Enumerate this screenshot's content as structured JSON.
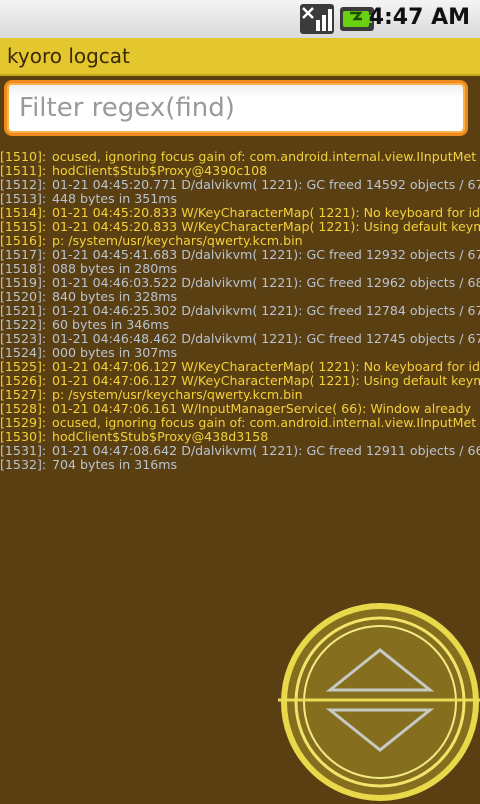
{
  "status_bar": {
    "time": "4:47 AM",
    "signal_icon": "signal-icon",
    "battery_icon": "battery-charging-icon"
  },
  "app": {
    "title": "kyoro logcat"
  },
  "filter": {
    "placeholder": "Filter regex(find)",
    "value": ""
  },
  "colors": {
    "background": "#5a3f12",
    "title_bar": "#e4c62f",
    "info_text": "#f2d23a",
    "debug_text": "#b9c4d0",
    "focus_orange": "#f08a1c"
  },
  "log": [
    {
      "num": "[1510]:",
      "text": "ocused, ignoring focus gain of: com.android.internal.view.IInputMet",
      "level": "I"
    },
    {
      "num": "[1511]:",
      "text": "hodClient$Stub$Proxy@4390c108",
      "level": "I"
    },
    {
      "num": "[1512]:",
      "text": "01-21 04:45:20.771 D/dalvikvm( 1221): GC freed 14592 objects / 67",
      "level": "D"
    },
    {
      "num": "[1513]:",
      "text": "448 bytes in 351ms",
      "level": "D"
    },
    {
      "num": "[1514]:",
      "text": "01-21 04:45:20.833 W/KeyCharacterMap( 1221): No keyboard for id",
      "level": "W"
    },
    {
      "num": "[1515]:",
      "text": "01-21 04:45:20.833 W/KeyCharacterMap( 1221): Using default keym",
      "level": "W"
    },
    {
      "num": "[1516]:",
      "text": "p: /system/usr/keychars/qwerty.kcm.bin",
      "level": "W"
    },
    {
      "num": "[1517]:",
      "text": "01-21 04:45:41.683 D/dalvikvm( 1221): GC freed 12932 objects / 67",
      "level": "D"
    },
    {
      "num": "[1518]:",
      "text": "088 bytes in 280ms",
      "level": "D"
    },
    {
      "num": "[1519]:",
      "text": "01-21 04:46:03.522 D/dalvikvm( 1221): GC freed 12962 objects / 68",
      "level": "D"
    },
    {
      "num": "[1520]:",
      "text": "840 bytes in 328ms",
      "level": "D"
    },
    {
      "num": "[1521]:",
      "text": "01-21 04:46:25.302 D/dalvikvm( 1221): GC freed 12784 objects / 67",
      "level": "D"
    },
    {
      "num": "[1522]:",
      "text": "60 bytes in 346ms",
      "level": "D"
    },
    {
      "num": "[1523]:",
      "text": "01-21 04:46:48.462 D/dalvikvm( 1221): GC freed 12745 objects / 67",
      "level": "D"
    },
    {
      "num": "[1524]:",
      "text": "000 bytes in 307ms",
      "level": "D"
    },
    {
      "num": "[1525]:",
      "text": "01-21 04:47:06.127 W/KeyCharacterMap( 1221): No keyboard for id",
      "level": "W"
    },
    {
      "num": "[1526]:",
      "text": "01-21 04:47:06.127 W/KeyCharacterMap( 1221): Using default keym",
      "level": "W"
    },
    {
      "num": "[1527]:",
      "text": "p: /system/usr/keychars/qwerty.kcm.bin",
      "level": "W"
    },
    {
      "num": "[1528]:",
      "text": "01-21 04:47:06.161 W/InputManagerService(   66): Window already",
      "level": "W"
    },
    {
      "num": "[1529]:",
      "text": "ocused, ignoring focus gain of: com.android.internal.view.IInputMet",
      "level": "I"
    },
    {
      "num": "[1530]:",
      "text": "hodClient$Stub$Proxy@438d3158",
      "level": "I"
    },
    {
      "num": "[1531]:",
      "text": "01-21 04:47:08.642 D/dalvikvm( 1221): GC freed 12911 objects / 66",
      "level": "D"
    },
    {
      "num": "[1532]:",
      "text": "704 bytes in 316ms",
      "level": "D"
    }
  ],
  "scroll_widget": {
    "icon": "scroll-up-down-icon"
  }
}
